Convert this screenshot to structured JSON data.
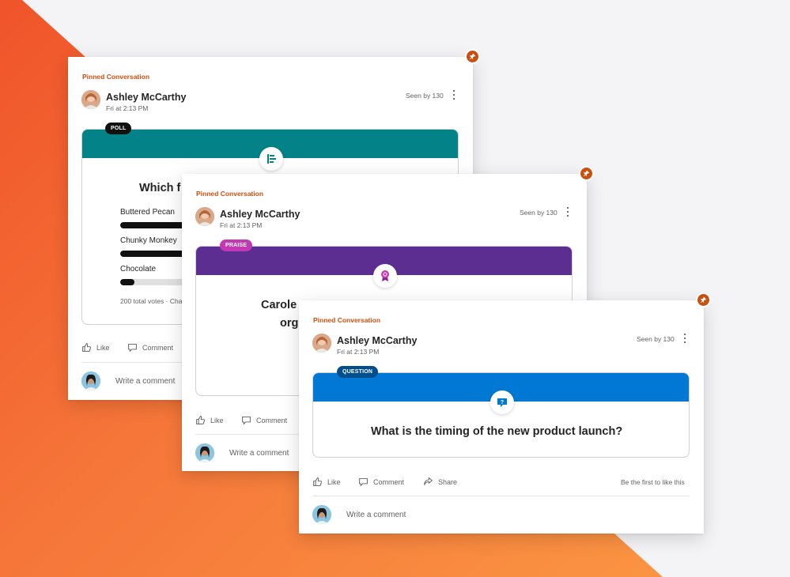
{
  "colors": {
    "accent_orange": "#ca5010",
    "poll_header": "#038387",
    "praise_header": "#5c2e91",
    "praise_badge": "#c239b3",
    "question_header": "#0078d4",
    "question_badge": "#004e8c"
  },
  "cards": [
    {
      "pinned_label": "Pinned Conversation",
      "author": "Ashley McCarthy",
      "time": "Fri at 2:13 PM",
      "seen_by": "Seen by 130",
      "post_type": "POLL",
      "post_icon": "poll-icon",
      "title": "Which f",
      "poll": {
        "options": [
          {
            "label": "Buttered Pecan",
            "percent": 55
          },
          {
            "label": "Chunky Monkey",
            "percent": 40
          },
          {
            "label": "Chocolate",
            "percent": 5
          }
        ],
        "footer": "200 total votes · Cha"
      },
      "actions": {
        "like": "Like",
        "comment": "Comment"
      },
      "comment_placeholder": "Write a comment"
    },
    {
      "pinned_label": "Pinned Conversation",
      "author": "Ashley McCarthy",
      "time": "Fri at 2:13 PM",
      "seen_by": "Seen by 130",
      "post_type": "PRAISE",
      "post_icon": "award-ribbon-icon",
      "title_line1": "Carole",
      "title_line2": "org",
      "actions": {
        "like": "Like",
        "comment": "Comment"
      },
      "comment_placeholder": "Write a comment"
    },
    {
      "pinned_label": "Pinned Conversation",
      "author": "Ashley McCarthy",
      "time": "Fri at 2:13 PM",
      "seen_by": "Seen by 130",
      "post_type": "QUESTION",
      "post_icon": "question-bubble-icon",
      "title": "What is the timing of the new product launch?",
      "actions": {
        "like": "Like",
        "comment": "Comment",
        "share": "Share"
      },
      "first_like": "Be the first to like this",
      "comment_placeholder": "Write a comment"
    }
  ]
}
